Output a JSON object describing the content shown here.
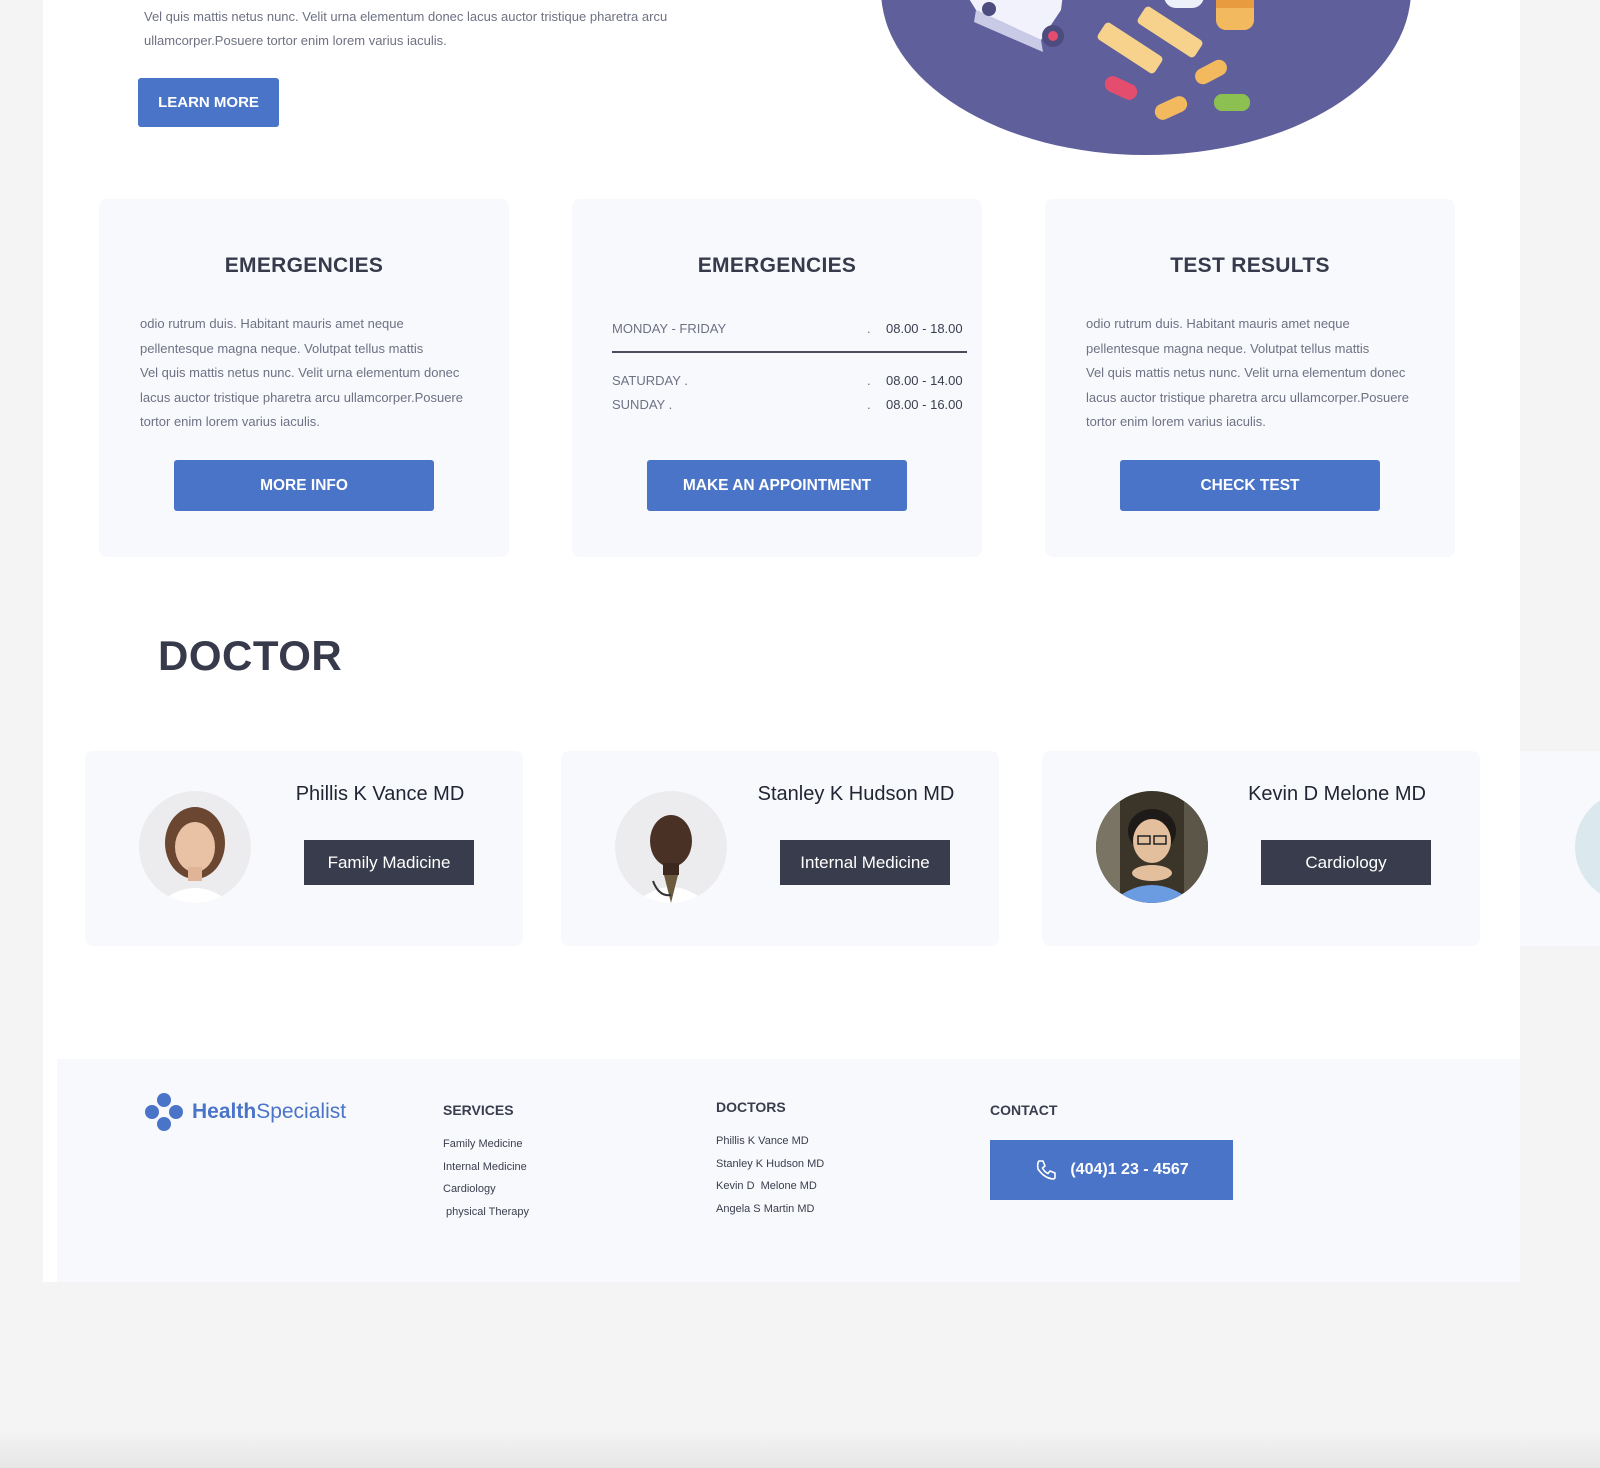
{
  "hero": {
    "text_line1": "Vel quis mattis netus nunc. Velit urna elementum donec lacus auctor tristique pharetra arcu",
    "text_line2": "ullamcorper.Posuere tortor enim lorem varius iaculis.",
    "learn_more_label": "LEARN MORE"
  },
  "cards": [
    {
      "title": "EMERGENCIES",
      "body": [
        "odio rutrum duis. Habitant mauris amet neque",
        "pellentesque magna neque. Volutpat tellus mattis",
        "Vel quis mattis netus nunc. Velit urna elementum donec",
        "lacus auctor tristique pharetra arcu ullamcorper.Posuere",
        "tortor enim lorem varius iaculis."
      ],
      "button": "MORE INFO"
    },
    {
      "title": "EMERGENCIES",
      "hours": [
        {
          "day": "MONDAY - FRIDAY",
          "dot": ".",
          "time": "08.00 - 18.00"
        },
        {
          "day": "SATURDAY .",
          "dot": ".",
          "time": "08.00 - 14.00"
        },
        {
          "day": "SUNDAY .",
          "dot": ".",
          "time": "08.00 - 16.00"
        }
      ],
      "button": "MAKE AN APPOINTMENT"
    },
    {
      "title": "TEST RESULTS",
      "body": [
        "odio rutrum duis. Habitant mauris amet neque",
        "pellentesque magna neque. Volutpat tellus mattis",
        "Vel quis mattis netus nunc. Velit urna elementum donec",
        "lacus auctor tristique pharetra arcu ullamcorper.Posuere",
        "tortor enim lorem varius iaculis."
      ],
      "button": "CHECK TEST"
    }
  ],
  "doctor_section": {
    "heading": "DOCTOR",
    "doctors": [
      {
        "name": "Phillis K Vance MD",
        "specialty": "Family Madicine"
      },
      {
        "name": "Stanley K Hudson MD",
        "specialty": "Internal Medicine"
      },
      {
        "name": "Kevin D Melone MD",
        "specialty": "Cardiology"
      }
    ]
  },
  "footer": {
    "logo_bold": "Health",
    "logo_regular": "Specialist",
    "services_heading": "SERVICES",
    "services": [
      "Family Medicine",
      "Internal Medicine",
      "Cardiology",
      " physical Therapy"
    ],
    "doctors_heading": "DOCTORS",
    "doctors": [
      "Phillis K Vance MD",
      "Stanley K Hudson MD",
      "Kevin D  Melone MD",
      "Angela S Martin MD"
    ],
    "contact_heading": "CONTACT",
    "phone": "(404)1 23 - 4567"
  },
  "colors": {
    "accent": "#4a74c8",
    "dark": "#393c4c",
    "card_bg": "#f8f9fd",
    "page_bg": "#f4f4f4"
  }
}
